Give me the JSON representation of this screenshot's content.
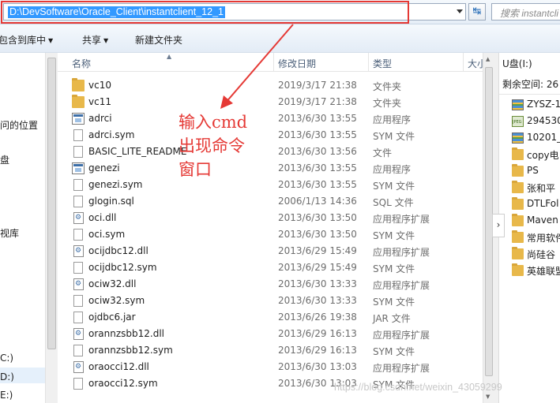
{
  "address_bar": {
    "path": "D:\\DevSoftware\\Oracle_Client\\instantclient_12_1",
    "search_placeholder": "搜索 instantcli"
  },
  "toolbar": {
    "include_library": "包含到库中",
    "share": "共享",
    "new_folder": "新建文件夹"
  },
  "nav": {
    "items": [
      "问的位置",
      "盘",
      "视库",
      "C:)",
      "D:)",
      "E:)"
    ]
  },
  "columns": {
    "name": "名称",
    "date": "修改日期",
    "type": "类型",
    "size": "大小"
  },
  "files": [
    {
      "name": "vc10",
      "date": "2019/3/17 21:38",
      "type": "文件夹",
      "icon": "folder"
    },
    {
      "name": "vc11",
      "date": "2019/3/17 21:38",
      "type": "文件夹",
      "icon": "folder"
    },
    {
      "name": "adrci",
      "date": "2013/6/30 13:55",
      "type": "应用程序",
      "icon": "exe"
    },
    {
      "name": "adrci.sym",
      "date": "2013/6/30 13:55",
      "type": "SYM 文件",
      "icon": "file"
    },
    {
      "name": "BASIC_LITE_README",
      "date": "2013/6/30 13:56",
      "type": "文件",
      "icon": "file"
    },
    {
      "name": "genezi",
      "date": "2013/6/30 13:55",
      "type": "应用程序",
      "icon": "exe"
    },
    {
      "name": "genezi.sym",
      "date": "2013/6/30 13:55",
      "type": "SYM 文件",
      "icon": "file"
    },
    {
      "name": "glogin.sql",
      "date": "2006/1/13 14:36",
      "type": "SQL 文件",
      "icon": "file"
    },
    {
      "name": "oci.dll",
      "date": "2013/6/30 13:50",
      "type": "应用程序扩展",
      "icon": "dll"
    },
    {
      "name": "oci.sym",
      "date": "2013/6/30 13:50",
      "type": "SYM 文件",
      "icon": "file"
    },
    {
      "name": "ocijdbc12.dll",
      "date": "2013/6/29 15:49",
      "type": "应用程序扩展",
      "icon": "dll"
    },
    {
      "name": "ocijdbc12.sym",
      "date": "2013/6/29 15:49",
      "type": "SYM 文件",
      "icon": "file"
    },
    {
      "name": "ociw32.dll",
      "date": "2013/6/30 13:33",
      "type": "应用程序扩展",
      "icon": "dll"
    },
    {
      "name": "ociw32.sym",
      "date": "2013/6/30 13:33",
      "type": "SYM 文件",
      "icon": "file"
    },
    {
      "name": "ojdbc6.jar",
      "date": "2013/6/26 19:38",
      "type": "JAR 文件",
      "icon": "file"
    },
    {
      "name": "orannzsbb12.dll",
      "date": "2013/6/29 16:13",
      "type": "应用程序扩展",
      "icon": "dll"
    },
    {
      "name": "orannzsbb12.sym",
      "date": "2013/6/29 16:13",
      "type": "SYM 文件",
      "icon": "file"
    },
    {
      "name": "oraocci12.dll",
      "date": "2013/6/30 13:03",
      "type": "应用程序扩展",
      "icon": "dll"
    },
    {
      "name": "oraocci12.sym",
      "date": "2013/6/30 13:03",
      "type": "SYM 文件",
      "icon": "file"
    }
  ],
  "annotation": {
    "line1": "输入cmd",
    "line2": "出现命令",
    "line3": "窗口",
    "color": "#e53935"
  },
  "details": {
    "title": "U盘(I:)",
    "free_space": "剩余空间: 26",
    "items": [
      {
        "label": "ZYSZ-1",
        "icon": "zip"
      },
      {
        "label": "294530",
        "icon": "jpeg"
      },
      {
        "label": "10201_",
        "icon": "zip"
      },
      {
        "label": "copy电",
        "icon": "folder"
      },
      {
        "label": "PS",
        "icon": "folder"
      },
      {
        "label": "张和平",
        "icon": "folder"
      },
      {
        "label": "DTLFol",
        "icon": "folder"
      },
      {
        "label": "Maven",
        "icon": "folder"
      },
      {
        "label": "常用软件",
        "icon": "folder"
      },
      {
        "label": "尚硅谷",
        "icon": "folder"
      },
      {
        "label": "英雄联盟",
        "icon": "folder"
      }
    ]
  },
  "watermark": "https://blog.csdn.net/weixin_43059299"
}
